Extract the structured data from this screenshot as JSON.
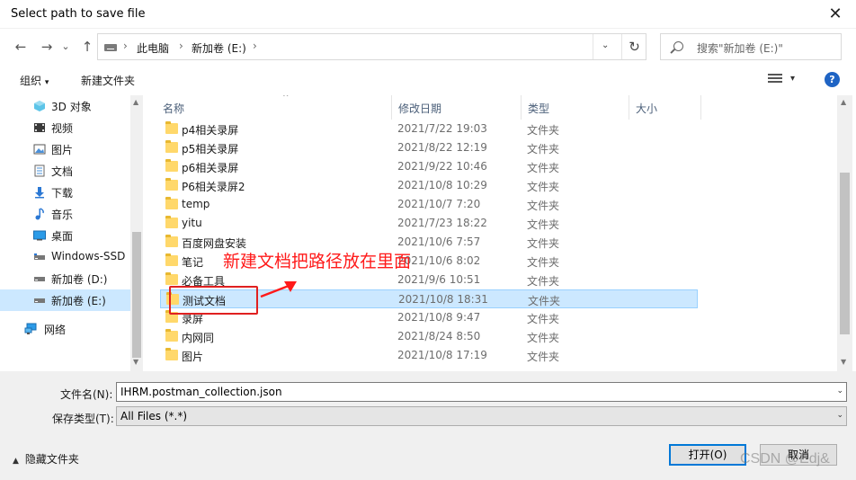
{
  "window": {
    "title": "Select path to save file",
    "close_glyph": "✕"
  },
  "address": {
    "back_glyph": "←",
    "forward_glyph": "→",
    "recent_glyph": "⌄",
    "up_glyph": "↑",
    "drive_icon": "drive-icon",
    "crumbs": [
      "此电脑",
      "新加卷 (E:)"
    ],
    "sep_glyph": "›",
    "dropdown_glyph": "⌄",
    "refresh_glyph": "↻",
    "search_placeholder": "搜索\"新加卷 (E:)\""
  },
  "toolbar": {
    "organize": "组织",
    "organize_caret": "▾",
    "new_folder": "新建文件夹",
    "view_caret": "▾",
    "help": "?"
  },
  "nav": {
    "items": [
      {
        "label": "3D 对象",
        "icon": "3d-objects-icon"
      },
      {
        "label": "视频",
        "icon": "videos-icon"
      },
      {
        "label": "图片",
        "icon": "pictures-icon"
      },
      {
        "label": "文档",
        "icon": "documents-icon"
      },
      {
        "label": "下载",
        "icon": "downloads-icon"
      },
      {
        "label": "音乐",
        "icon": "music-icon"
      },
      {
        "label": "桌面",
        "icon": "desktop-icon"
      },
      {
        "label": "Windows-SSD",
        "icon": "drive-icon"
      },
      {
        "label": "新加卷 (D:)",
        "icon": "drive-icon"
      },
      {
        "label": "新加卷 (E:)",
        "icon": "drive-icon",
        "selected": true
      },
      {
        "label": "网络",
        "icon": "network-icon"
      }
    ],
    "scroll_up": "▲",
    "scroll_down": "▼"
  },
  "files": {
    "columns": {
      "name": "名称",
      "date": "修改日期",
      "type": "类型",
      "size": "大小",
      "sort_glyph": "^"
    },
    "rows": [
      {
        "name": "p4相关录屏",
        "date": "2021/7/22 19:03",
        "type": "文件夹"
      },
      {
        "name": "p5相关录屏",
        "date": "2021/8/22 12:19",
        "type": "文件夹"
      },
      {
        "name": "p6相关录屏",
        "date": "2021/9/22 10:46",
        "type": "文件夹"
      },
      {
        "name": "P6相关录屏2",
        "date": "2021/10/8 10:29",
        "type": "文件夹"
      },
      {
        "name": "temp",
        "date": "2021/10/7 7:20",
        "type": "文件夹"
      },
      {
        "name": "yitu",
        "date": "2021/7/23 18:22",
        "type": "文件夹"
      },
      {
        "name": "百度网盘安装",
        "date": "2021/10/6 7:57",
        "type": "文件夹"
      },
      {
        "name": "笔记",
        "date": "2021/10/6 8:02",
        "type": "文件夹"
      },
      {
        "name": "必备工具",
        "date": "2021/9/6 10:51",
        "type": "文件夹"
      },
      {
        "name": "测试文档",
        "date": "2021/10/8 18:31",
        "type": "文件夹",
        "selected": true
      },
      {
        "name": "录屏",
        "date": "2021/10/8 9:47",
        "type": "文件夹"
      },
      {
        "name": "内网同",
        "date": "2021/8/24 8:50",
        "type": "文件夹"
      },
      {
        "name": "图片",
        "date": "2021/10/8 17:19",
        "type": "文件夹"
      }
    ],
    "scroll_up": "▲",
    "scroll_down": "▼"
  },
  "bottom": {
    "filename_label": "文件名(N):",
    "filename_value": "IHRM.postman_collection.json",
    "filetype_label": "保存类型(T):",
    "filetype_value": "All Files (*.*)",
    "dd_glyph": "⌄",
    "hide_folders": "隐藏文件夹",
    "hide_caret": "▲",
    "open_button": "打开(O)",
    "cancel_button": "取消"
  },
  "annotation": {
    "text": "新建文档把路径放在里面",
    "color": "#ff1a1a"
  },
  "watermark": "CSDN @Edj&"
}
